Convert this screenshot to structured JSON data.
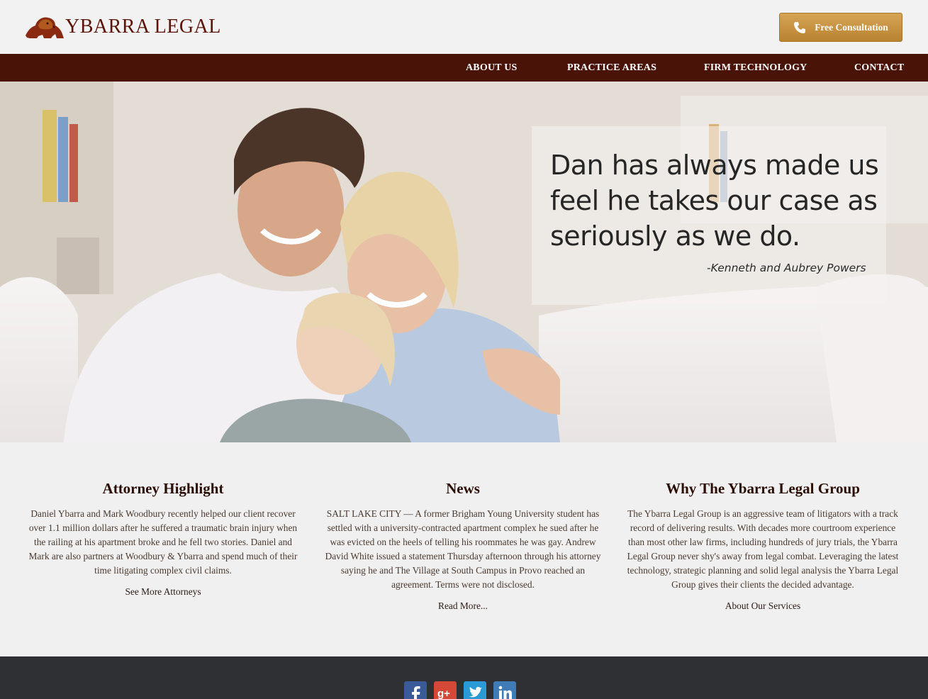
{
  "header": {
    "brand": "YBARRA LEGAL",
    "consultation_label": "Free Consultation"
  },
  "nav": {
    "items": [
      {
        "label": "ABOUT US"
      },
      {
        "label": "PRACTICE AREAS"
      },
      {
        "label": "FIRM TECHNOLOGY"
      },
      {
        "label": "CONTACT"
      }
    ]
  },
  "hero": {
    "quote": "Dan has always made us feel he takes our case as seriously as we do.",
    "author": "-Kenneth and Aubrey Powers"
  },
  "columns": [
    {
      "title": "Attorney Highlight",
      "body": "Daniel Ybarra and Mark Woodbury recently helped our client recover over 1.1 million dollars after he suffered a traumatic brain injury when the railing at his apartment broke and he fell two stories.  Daniel and Mark are also partners at Woodbury & Ybarra and spend much of their time litigating complex civil claims.",
      "link": "See More Attorneys"
    },
    {
      "title": "News",
      "body": "SALT LAKE CITY — A former Brigham Young University student has settled with a university-contracted apartment complex he sued after he was evicted on the heels of telling his roommates he was gay.  Andrew David White issued a statement Thursday afternoon through his attorney saying he and The Village at South Campus in Provo reached an agreement. Terms were not disclosed.",
      "link": "Read More..."
    },
    {
      "title": "Why The Ybarra Legal Group",
      "body": "The Ybarra Legal Group is an aggressive team of litigators with a track record of delivering results. With decades more courtroom experience than most other law firms, including hundreds of jury trials, the Ybarra Legal Group never shy's away from legal combat. Leveraging the latest technology, strategic planning and solid legal analysis the Ybarra Legal Group gives their clients the decided advantage.",
      "link": "About Our Services"
    }
  ],
  "footer": {
    "social_icons": [
      "facebook-icon",
      "google-plus-icon",
      "twitter-icon",
      "linkedin-icon"
    ]
  },
  "colors": {
    "brand": "#5a1409",
    "nav_bg": "#4a1308",
    "button_gold": "#c8923e",
    "footer_bg": "#2f3033"
  }
}
